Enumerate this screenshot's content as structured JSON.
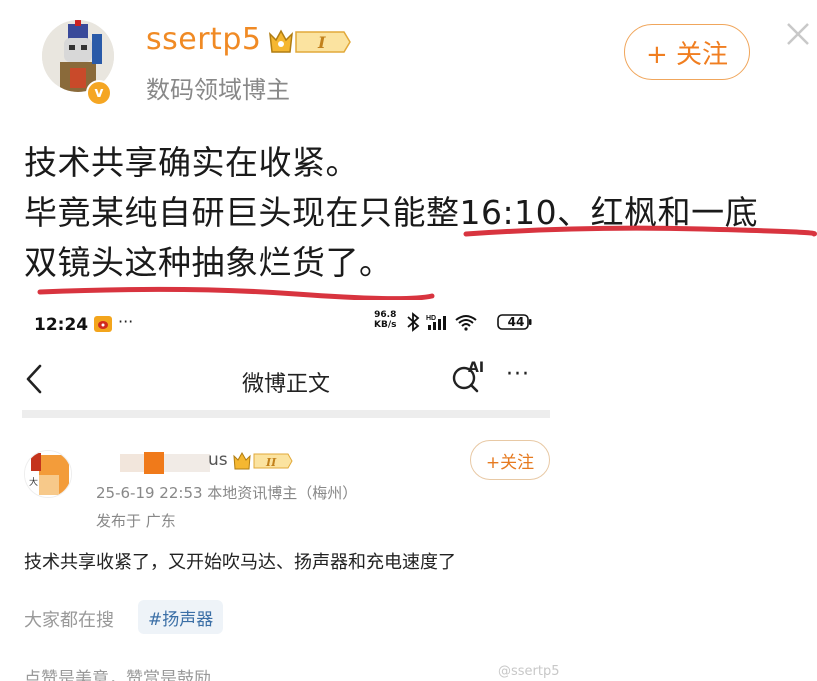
{
  "post": {
    "username": "ssertp5",
    "vip_level": "I",
    "verified_mark": "v",
    "subtitle": "数码领域博主",
    "follow_label": "+ 关注",
    "lines": [
      "技术共享确实在收紧。",
      "毕竟某纯自研巨头现在只能整16:10、红枫和一底",
      "双镜头这种抽象烂货了。"
    ]
  },
  "embedded": {
    "status_bar": {
      "time": "12:24",
      "more": "···",
      "net_speed": "96.8",
      "net_unit": "KB/s",
      "battery": "44"
    },
    "nav": {
      "title": "微博正文",
      "ai_label": "AI",
      "more": "···"
    },
    "author": {
      "name_visible": "us",
      "vip_level": "II",
      "meta": "25-6-19 22:53  本地资讯博主（梅州）",
      "location": "发布于 广东",
      "follow_label": "+关注"
    },
    "text": "技术共享收紧了，又开始吹马达、扬声器和充电速度了",
    "search_label": "大家都在搜",
    "tag": "#扬声器",
    "bottom_text": "点赞是美意，赞赏是鼓励"
  },
  "watermark": "@ssertp5",
  "colors": {
    "accent_orange": "#f08a24",
    "underline_red": "#d8343f",
    "tag_blue": "#3b6fa6"
  }
}
